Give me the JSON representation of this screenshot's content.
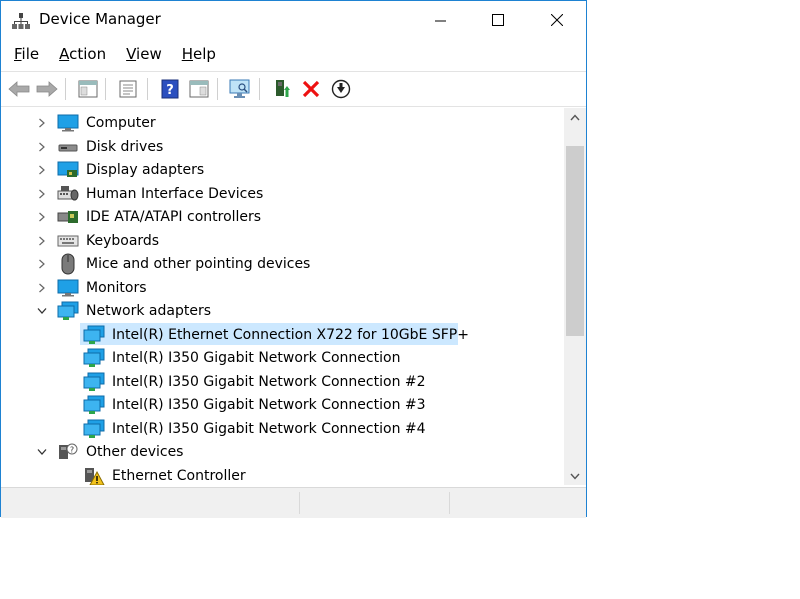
{
  "window": {
    "title": "Device Manager",
    "accent_color": "#1e82d2"
  },
  "menu": [
    {
      "label": "File",
      "underline": "F",
      "rest": "ile"
    },
    {
      "label": "Action",
      "underline": "A",
      "rest": "ction"
    },
    {
      "label": "View",
      "underline": "V",
      "rest": "iew"
    },
    {
      "label": "Help",
      "underline": "H",
      "rest": "elp"
    }
  ],
  "toolbar": {
    "buttons": [
      "back-icon",
      "forward-icon",
      "properties-pane-icon",
      "console-tree-icon",
      "help-icon",
      "action-pane-icon",
      "scan-hardware-icon",
      "update-driver-icon",
      "uninstall-icon",
      "disable-device-icon"
    ]
  },
  "tree": {
    "items": [
      {
        "label": "Computer",
        "icon": "computer-icon",
        "expanded": false
      },
      {
        "label": "Disk drives",
        "icon": "disk-drive-icon",
        "expanded": false
      },
      {
        "label": "Display adapters",
        "icon": "display-adapter-icon",
        "expanded": false
      },
      {
        "label": "Human Interface Devices",
        "icon": "hid-icon",
        "expanded": false
      },
      {
        "label": "IDE ATA/ATAPI controllers",
        "icon": "ide-controller-icon",
        "expanded": false
      },
      {
        "label": "Keyboards",
        "icon": "keyboard-icon",
        "expanded": false
      },
      {
        "label": "Mice and other pointing devices",
        "icon": "mouse-icon",
        "expanded": false
      },
      {
        "label": "Monitors",
        "icon": "monitor-icon",
        "expanded": false
      },
      {
        "label": "Network adapters",
        "icon": "network-adapter-icon",
        "expanded": true
      },
      {
        "label": "Other devices",
        "icon": "other-devices-icon",
        "expanded": true
      }
    ],
    "network_children": [
      {
        "label": "Intel(R) Ethernet Connection X722 for 10GbE SFP+",
        "selected": true
      },
      {
        "label": "Intel(R) I350 Gigabit Network Connection",
        "selected": false
      },
      {
        "label": "Intel(R) I350 Gigabit Network Connection #2",
        "selected": false
      },
      {
        "label": "Intel(R) I350 Gigabit Network Connection #3",
        "selected": false
      },
      {
        "label": "Intel(R) I350 Gigabit Network Connection #4",
        "selected": false
      }
    ],
    "other_children": [
      {
        "label": "Ethernet Controller",
        "icon": "warning-device-icon"
      }
    ],
    "selection_color": "#cce8ff"
  }
}
